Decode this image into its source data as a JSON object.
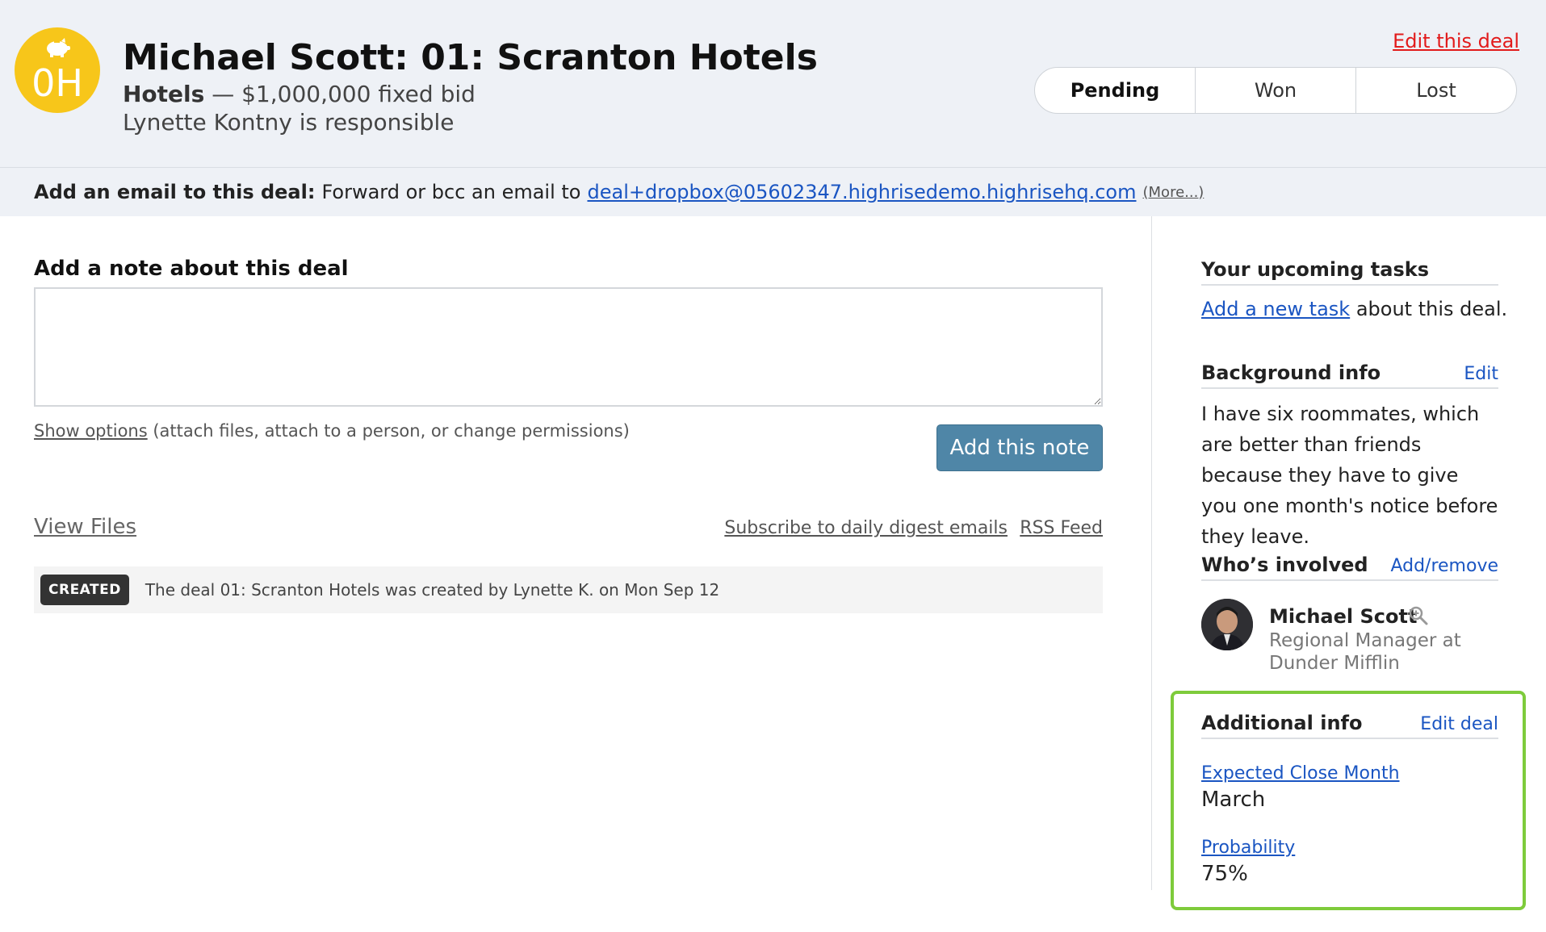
{
  "header": {
    "badge_initials": "0H",
    "badge_icon": "piggy-bank-icon",
    "title": "Michael Scott: 01: Scranton Hotels",
    "category": "Hotels",
    "value_text": " — $1,000,000 fixed bid",
    "responsible": "Lynette Kontny is responsible",
    "edit_link": "Edit this deal",
    "status_options": [
      "Pending",
      "Won",
      "Lost"
    ],
    "selected_status": "Pending"
  },
  "email_bar": {
    "label": "Add an email to this deal:",
    "text": "Forward or bcc an email to",
    "address": "deal+dropbox@05602347.highrisedemo.highrisehq.com",
    "more": "(More...)"
  },
  "note": {
    "heading": "Add a note about this deal",
    "textarea_value": "",
    "show_options_link": "Show options",
    "show_options_hint": " (attach files, attach to a person, or change permissions)",
    "submit_label": "Add this note"
  },
  "links": {
    "view_files": "View Files",
    "subscribe": "Subscribe to daily digest emails",
    "rss": "RSS Feed"
  },
  "activity": [
    {
      "badge": "CREATED",
      "text": "The deal 01: Scranton Hotels was created by Lynette K. on Mon Sep 12"
    }
  ],
  "sidebar": {
    "tasks": {
      "title": "Your upcoming tasks",
      "link": "Add a new task",
      "suffix": " about this deal."
    },
    "background": {
      "title": "Background info",
      "action": "Edit",
      "text": "I have six roommates, which are better than friends because they have to give you one month's notice before they leave."
    },
    "involved": {
      "title": "Who’s involved",
      "action": "Add/remove",
      "person_name": "Michael Scott",
      "person_title": "Regional Manager at Dunder Mifflin"
    },
    "additional": {
      "title": "Additional info",
      "action": "Edit deal",
      "fields": [
        {
          "label": "Expected Close Month",
          "value": "March"
        },
        {
          "label": "Probability",
          "value": "75%"
        }
      ]
    }
  },
  "colors": {
    "badge": "#f7c61a",
    "link": "#1a55c2",
    "edit_red": "#e21b1b",
    "button": "#4f86a7",
    "highlight": "#7ecb3b"
  }
}
